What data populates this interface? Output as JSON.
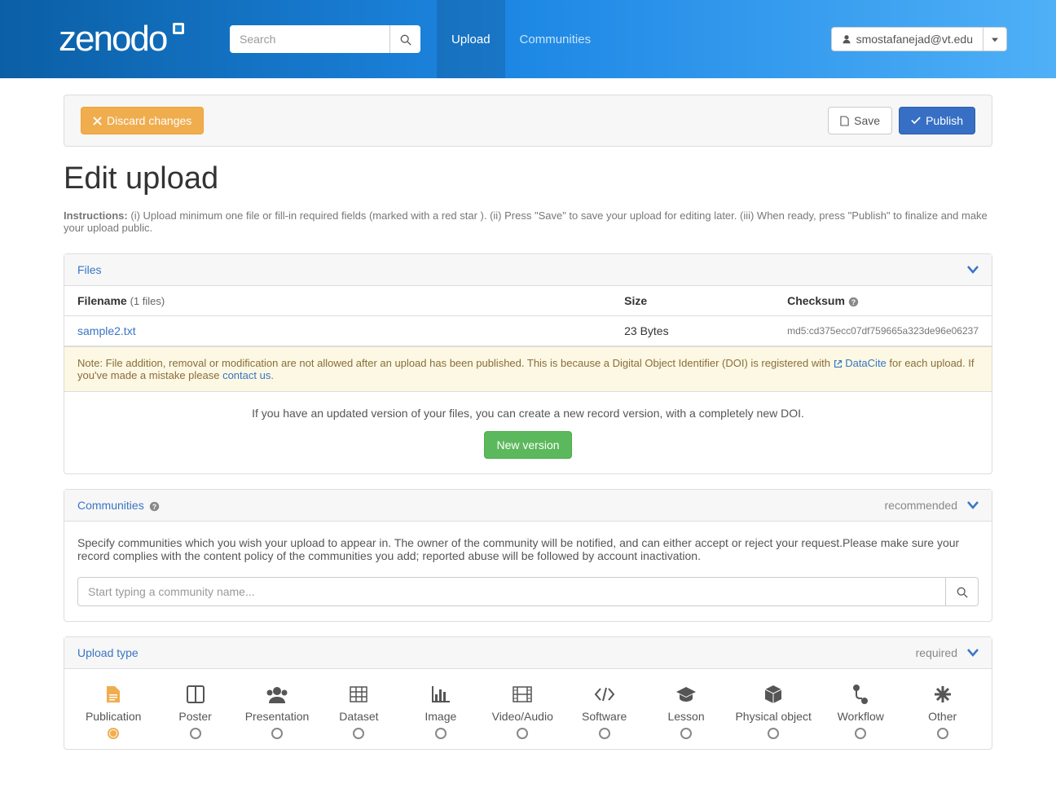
{
  "nav": {
    "search_placeholder": "Search",
    "links": [
      {
        "label": "Upload",
        "active": true
      },
      {
        "label": "Communities",
        "active": false
      }
    ],
    "user": "smostafanejad@vt.edu"
  },
  "actions": {
    "discard": "Discard changes",
    "save": "Save",
    "publish": "Publish"
  },
  "page": {
    "heading": "Edit upload",
    "instructions_label": "Instructions:",
    "instructions_text": "(i) Upload minimum one file or fill-in required fields (marked with a red star ). (ii) Press \"Save\" to save your upload for editing later. (iii) When ready, press \"Publish\" to finalize and make your upload public."
  },
  "files_panel": {
    "title": "Files",
    "col_filename": "Filename",
    "col_filename_sub": "(1 files)",
    "col_size": "Size",
    "col_checksum": "Checksum",
    "rows": [
      {
        "name": "sample2.txt",
        "size": "23 Bytes",
        "checksum": "md5:cd375ecc07df759665a323de96e06237"
      }
    ],
    "note_pre": "Note: File addition, removal or modification are not allowed after an upload has been published. This is because a Digital Object Identifier (DOI) is registered with ",
    "note_link1": "DataCite",
    "note_mid": " for each upload. If you've made a mistake please ",
    "note_link2": "contact us",
    "note_post": ".",
    "version_text": "If you have an updated version of your files, you can create a new record version, with a completely new DOI.",
    "new_version": "New version"
  },
  "communities_panel": {
    "title": "Communities",
    "badge": "recommended",
    "body": "Specify communities which you wish your upload to appear in. The owner of the community will be notified, and can either accept or reject your request.Please make sure your record complies with the content policy of the communities you add; reported abuse will be followed by account inactivation.",
    "placeholder": "Start typing a community name..."
  },
  "upload_type_panel": {
    "title": "Upload type",
    "badge": "required",
    "types": [
      {
        "label": "Publication",
        "icon": "file-text",
        "selected": true
      },
      {
        "label": "Poster",
        "icon": "columns",
        "selected": false
      },
      {
        "label": "Presentation",
        "icon": "users",
        "selected": false
      },
      {
        "label": "Dataset",
        "icon": "table",
        "selected": false
      },
      {
        "label": "Image",
        "icon": "bar-chart",
        "selected": false
      },
      {
        "label": "Video/Audio",
        "icon": "film",
        "selected": false
      },
      {
        "label": "Software",
        "icon": "code",
        "selected": false
      },
      {
        "label": "Lesson",
        "icon": "grad-cap",
        "selected": false
      },
      {
        "label": "Physical object",
        "icon": "cube",
        "selected": false
      },
      {
        "label": "Workflow",
        "icon": "workflow",
        "selected": false
      },
      {
        "label": "Other",
        "icon": "asterisk",
        "selected": false
      }
    ]
  }
}
